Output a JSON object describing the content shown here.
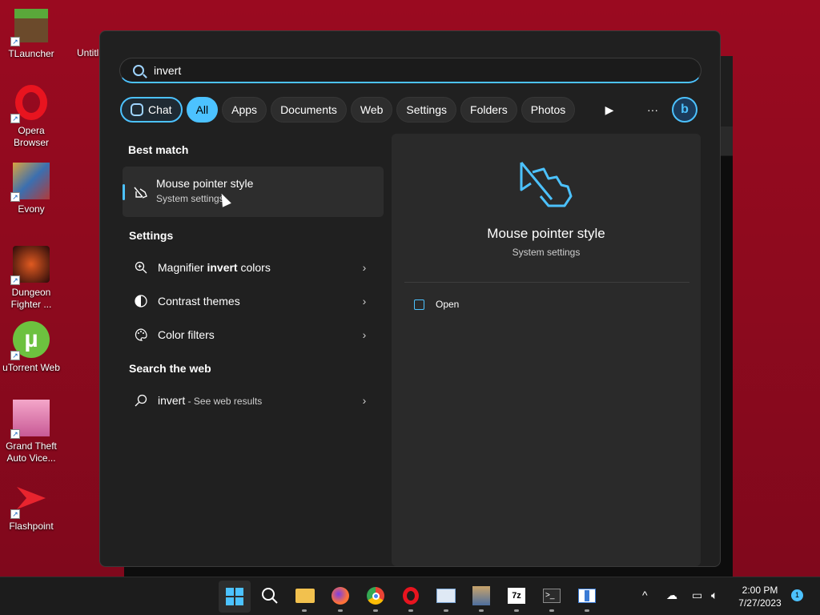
{
  "desktop": {
    "icons": [
      {
        "label": "TLauncher",
        "icon": "tlauncher-icon"
      },
      {
        "label": "Opera Browser",
        "icon": "opera-icon"
      },
      {
        "label": "Evony",
        "icon": "evony-icon"
      },
      {
        "label": "Dungeon Fighter ...",
        "icon": "dungeon-fighter-icon"
      },
      {
        "label": "uTorrent Web",
        "icon": "utorrent-icon"
      },
      {
        "label": "Grand Theft Auto Vice...",
        "icon": "gta-icon"
      },
      {
        "label": "Flashpoint",
        "icon": "flashpoint-icon"
      }
    ],
    "partial_label": "Untitl"
  },
  "search": {
    "query": "invert"
  },
  "filters": {
    "chat": "Chat",
    "all": "All",
    "apps": "Apps",
    "documents": "Documents",
    "web": "Web",
    "settings": "Settings",
    "folders": "Folders",
    "photos": "Photos",
    "more": "···"
  },
  "results": {
    "best_match_heading": "Best match",
    "best_match": {
      "title": "Mouse pointer style",
      "subtitle": "System settings"
    },
    "settings_heading": "Settings",
    "settings_items": [
      {
        "pre": "Magnifier ",
        "bold": "invert",
        "post": " colors"
      },
      {
        "label": "Contrast themes"
      },
      {
        "label": "Color filters"
      }
    ],
    "web_heading": "Search the web",
    "web_item": {
      "query": "invert",
      "suffix": " - See web results"
    }
  },
  "preview": {
    "title": "Mouse pointer style",
    "subtitle": "System settings",
    "open_label": "Open"
  },
  "taskbar": {
    "time": "2:00 PM",
    "date": "7/27/2023",
    "notification_count": "1"
  },
  "colors": {
    "accent": "#4cc2ff",
    "desktop": "#8d0a1e",
    "panel": "#202020"
  }
}
